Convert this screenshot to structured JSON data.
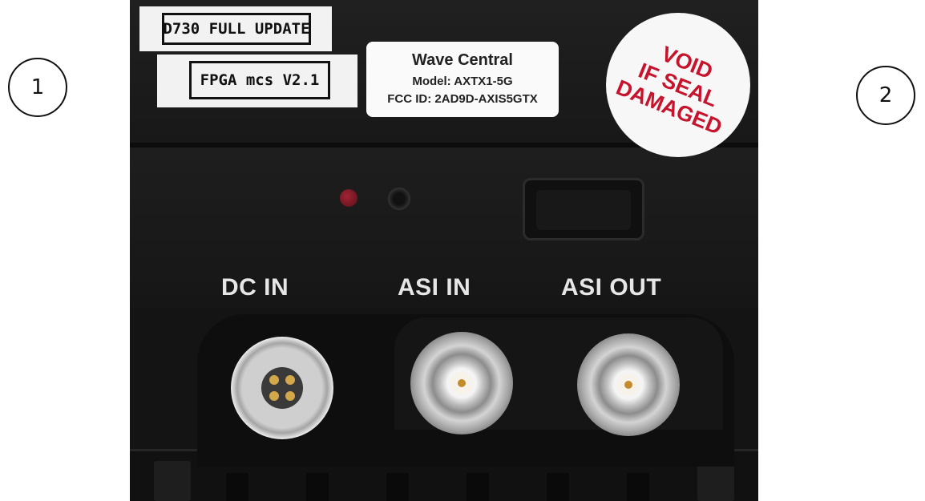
{
  "callouts": [
    "1",
    "2"
  ],
  "stickers": {
    "firmware": "D730 FULL UPDATE",
    "fpga": "FPGA mcs V2.1"
  },
  "fcc_label": {
    "brand": "Wave Central",
    "model": "Model: AXTX1-5G",
    "fcc_id": "FCC ID: 2AD9D-AXIS5GTX"
  },
  "seal": {
    "line1": "VOID",
    "line2": "IF SEAL",
    "line3": "DAMAGED",
    "color": "#c7142c"
  },
  "ports": {
    "dc_in": "DC IN",
    "asi_in": "ASI IN",
    "asi_out": "ASI OUT"
  },
  "colors": {
    "device_body": "#1b1b1b",
    "label_text": "#e6e6e6",
    "led_red": "#a02434"
  }
}
